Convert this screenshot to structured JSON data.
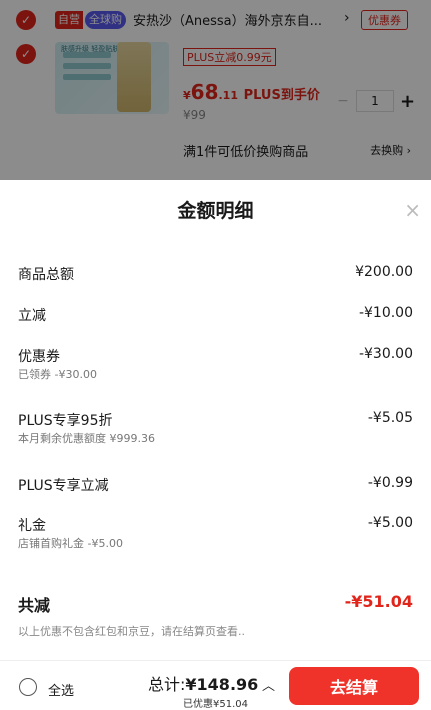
{
  "cart_item": {
    "tag_self": "自营",
    "tag_global": "全球购",
    "title": "安热沙（Anessa）海外京东自...",
    "title_arrow": "›",
    "coupon_label": "优惠券",
    "thumb_text": "肤感升级 轻盈贴肤",
    "plus_discount_tag": "PLUS立减0.99元",
    "price_symbol": "¥",
    "price_integer": "68",
    "price_decimal": ".11",
    "price_plus_label": "PLUS到手价",
    "original_price": "¥99",
    "quantity": "1",
    "minus_symbol": "−",
    "add_symbol": "+",
    "promo_text": "满1件可低价换购商品",
    "promo_link": "去换购 ›"
  },
  "sheet": {
    "title": "金额明细",
    "close_symbol": "×",
    "rows": [
      {
        "label": "商品总额",
        "value": "¥200.00",
        "sub": ""
      },
      {
        "label": "立减",
        "value": "-¥10.00",
        "sub": ""
      },
      {
        "label": "优惠券",
        "value": "-¥30.00",
        "sub": "已领券 -¥30.00"
      },
      {
        "label": "PLUS专享95折",
        "value": "-¥5.05",
        "sub": "本月剩余优惠额度 ¥999.36"
      },
      {
        "label": "PLUS专享立减",
        "value": "-¥0.99",
        "sub": ""
      },
      {
        "label": "礼金",
        "value": "-¥5.00",
        "sub": "店铺首购礼金 -¥5.00"
      }
    ],
    "total_label": "共减",
    "total_value": "-¥51.04",
    "note": "以上优惠不包含红包和京豆，请在结算页查看.."
  },
  "footer": {
    "select_all": "全选",
    "total_prefix": "总计:",
    "total_amount": "¥148.96",
    "saved_text": "已优惠¥51.04",
    "chevron": "︿",
    "checkout": "去结算"
  },
  "colors": {
    "accent": "#e1251b",
    "checkout_button": "#f0332a",
    "global_tag": "#5a5af0"
  }
}
